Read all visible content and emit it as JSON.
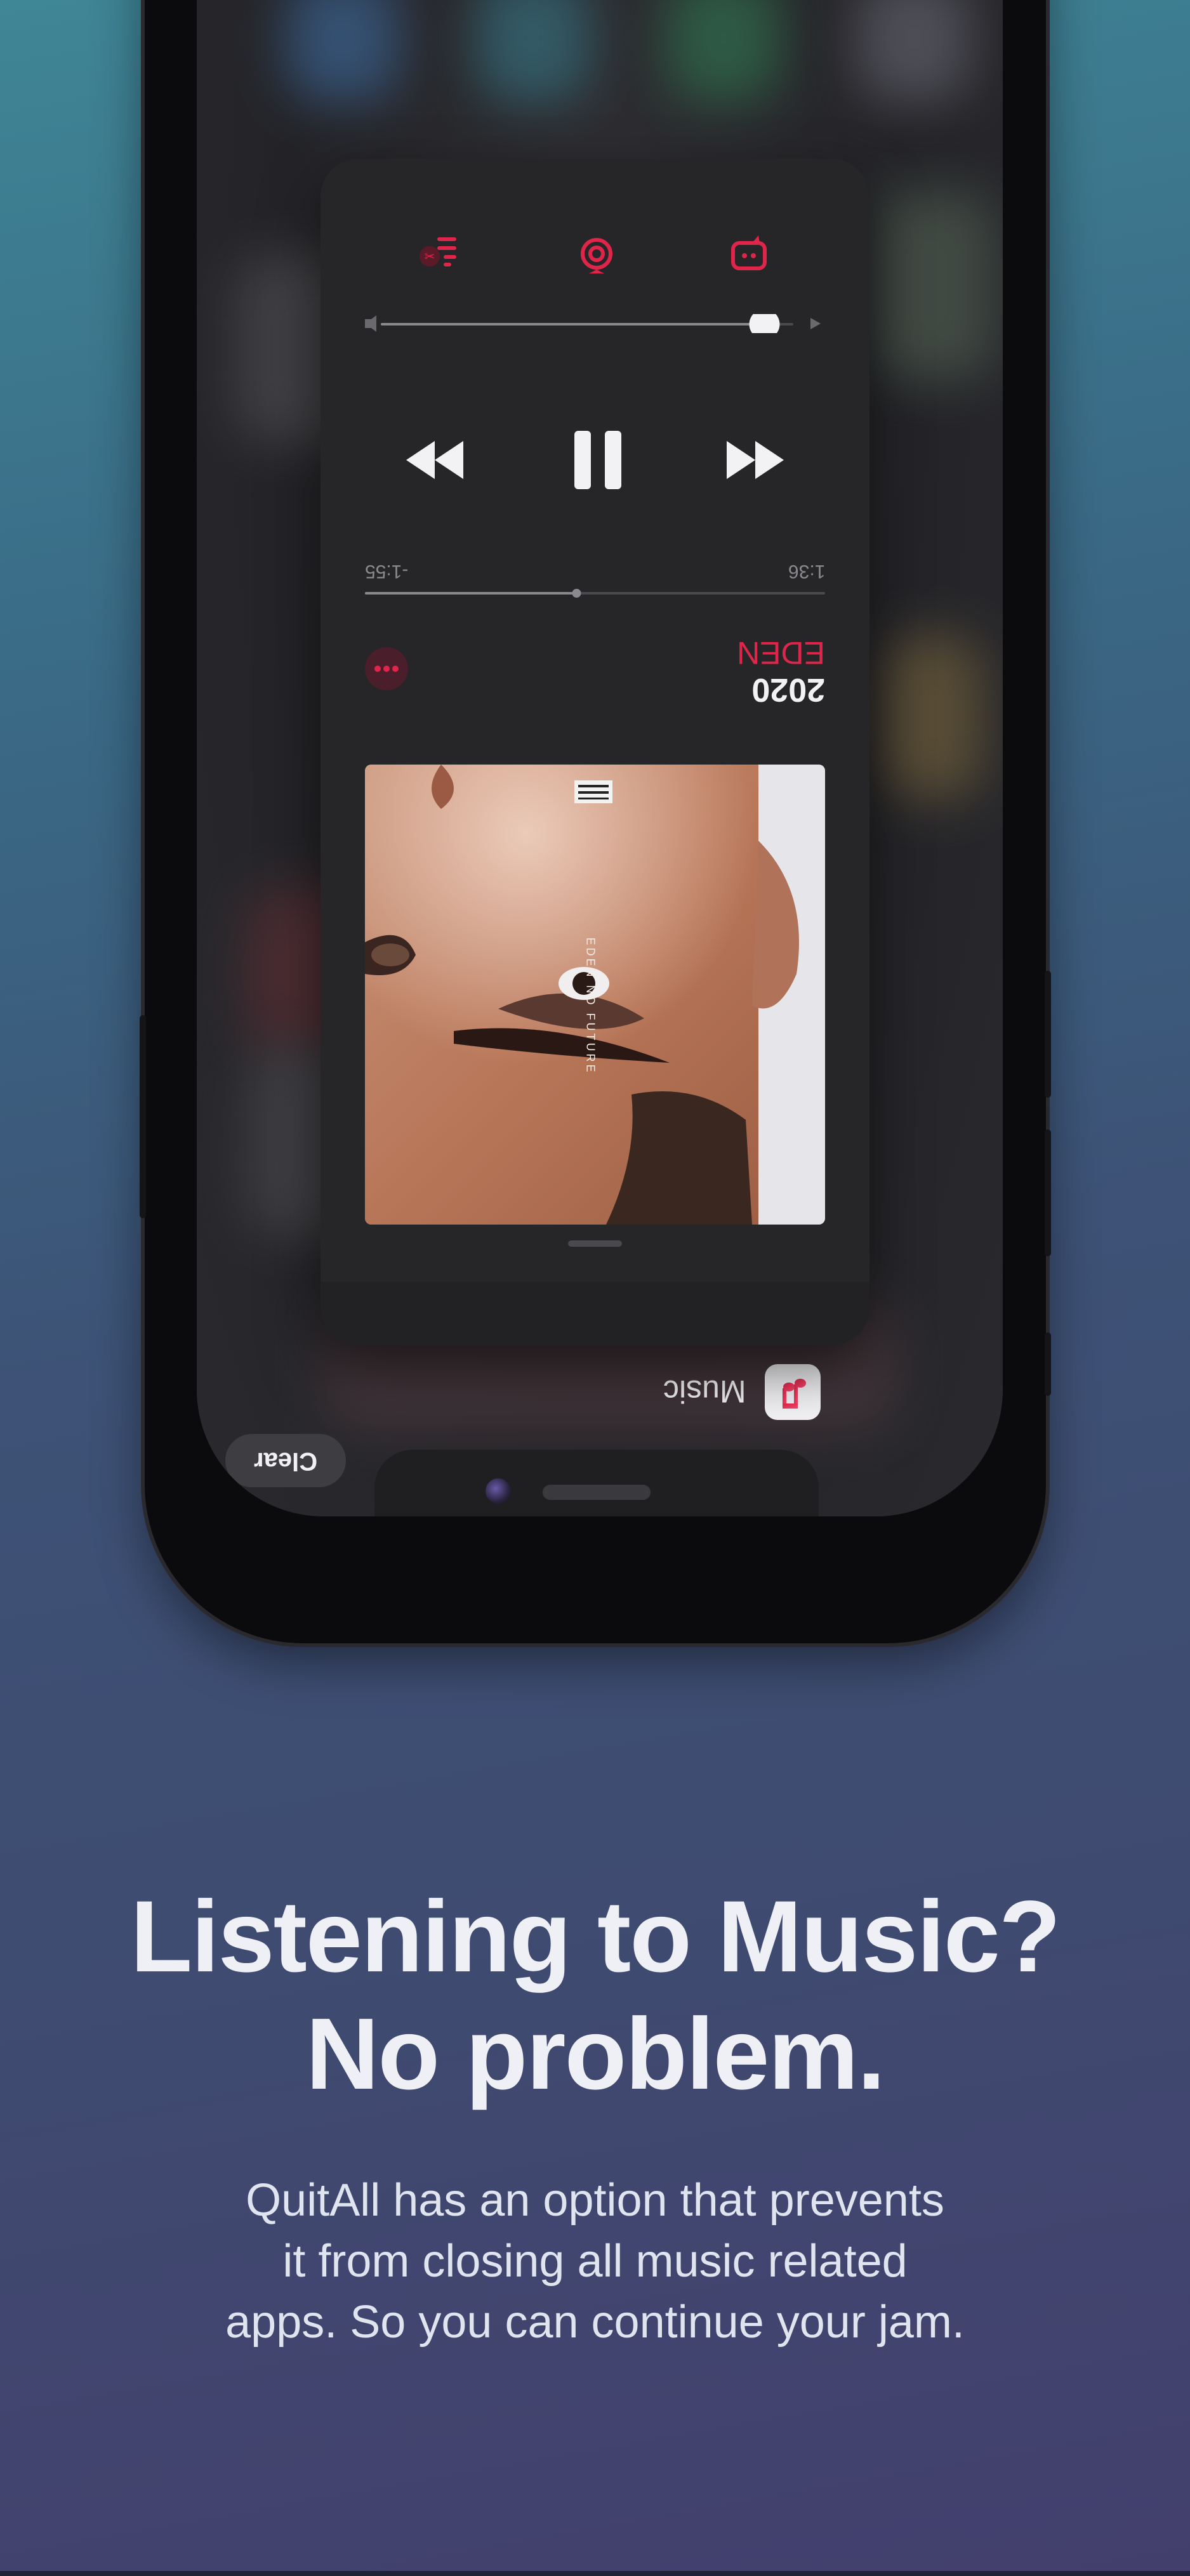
{
  "player": {
    "time_elapsed": "1:36",
    "time_remaining": "-1:55",
    "year": "2020",
    "artist": "EDEN",
    "album_cover_text": "EDEN NO FUTURE",
    "progress_fraction": 0.54,
    "volume_fraction": 0.93
  },
  "switcher": {
    "app_label": "Music",
    "clear_label": "Clear"
  },
  "marketing": {
    "headline_line1": "Listening to Music?",
    "headline_line2": "No problem.",
    "body_line1": "QuitAll has an option that prevents",
    "body_line2": "it from closing all music related",
    "body_line3": "apps. So you can continue your jam."
  },
  "colors": {
    "accent": "#e0254a",
    "card": "#262628",
    "background_top": "#3f8696",
    "background_bottom": "#433f6d"
  },
  "icons": [
    "queue-icon",
    "airplay-icon",
    "lyrics-icon",
    "rewind-icon",
    "pause-icon",
    "forward-icon",
    "more-icon",
    "music-app-icon",
    "camera-icon"
  ]
}
